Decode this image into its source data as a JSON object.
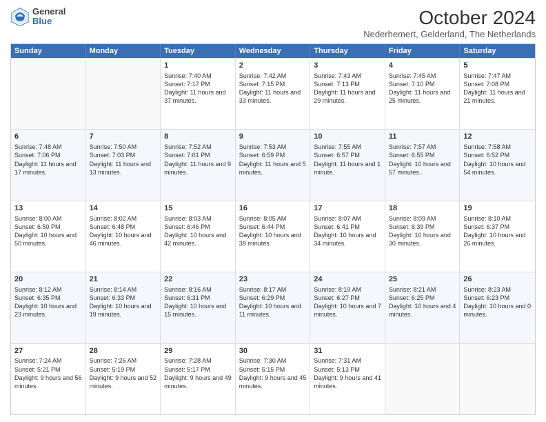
{
  "logo": {
    "general": "General",
    "blue": "Blue"
  },
  "title": "October 2024",
  "subtitle": "Nederhemert, Gelderland, The Netherlands",
  "days": [
    "Sunday",
    "Monday",
    "Tuesday",
    "Wednesday",
    "Thursday",
    "Friday",
    "Saturday"
  ],
  "weeks": [
    [
      {
        "num": "",
        "sunrise": "",
        "sunset": "",
        "daylight": ""
      },
      {
        "num": "",
        "sunrise": "",
        "sunset": "",
        "daylight": ""
      },
      {
        "num": "1",
        "sunrise": "Sunrise: 7:40 AM",
        "sunset": "Sunset: 7:17 PM",
        "daylight": "Daylight: 11 hours and 37 minutes."
      },
      {
        "num": "2",
        "sunrise": "Sunrise: 7:42 AM",
        "sunset": "Sunset: 7:15 PM",
        "daylight": "Daylight: 11 hours and 33 minutes."
      },
      {
        "num": "3",
        "sunrise": "Sunrise: 7:43 AM",
        "sunset": "Sunset: 7:13 PM",
        "daylight": "Daylight: 11 hours and 29 minutes."
      },
      {
        "num": "4",
        "sunrise": "Sunrise: 7:45 AM",
        "sunset": "Sunset: 7:10 PM",
        "daylight": "Daylight: 11 hours and 25 minutes."
      },
      {
        "num": "5",
        "sunrise": "Sunrise: 7:47 AM",
        "sunset": "Sunset: 7:08 PM",
        "daylight": "Daylight: 11 hours and 21 minutes."
      }
    ],
    [
      {
        "num": "6",
        "sunrise": "Sunrise: 7:48 AM",
        "sunset": "Sunset: 7:06 PM",
        "daylight": "Daylight: 11 hours and 17 minutes."
      },
      {
        "num": "7",
        "sunrise": "Sunrise: 7:50 AM",
        "sunset": "Sunset: 7:03 PM",
        "daylight": "Daylight: 11 hours and 13 minutes."
      },
      {
        "num": "8",
        "sunrise": "Sunrise: 7:52 AM",
        "sunset": "Sunset: 7:01 PM",
        "daylight": "Daylight: 11 hours and 9 minutes."
      },
      {
        "num": "9",
        "sunrise": "Sunrise: 7:53 AM",
        "sunset": "Sunset: 6:59 PM",
        "daylight": "Daylight: 11 hours and 5 minutes."
      },
      {
        "num": "10",
        "sunrise": "Sunrise: 7:55 AM",
        "sunset": "Sunset: 6:57 PM",
        "daylight": "Daylight: 11 hours and 1 minute."
      },
      {
        "num": "11",
        "sunrise": "Sunrise: 7:57 AM",
        "sunset": "Sunset: 6:55 PM",
        "daylight": "Daylight: 10 hours and 57 minutes."
      },
      {
        "num": "12",
        "sunrise": "Sunrise: 7:58 AM",
        "sunset": "Sunset: 6:52 PM",
        "daylight": "Daylight: 10 hours and 54 minutes."
      }
    ],
    [
      {
        "num": "13",
        "sunrise": "Sunrise: 8:00 AM",
        "sunset": "Sunset: 6:50 PM",
        "daylight": "Daylight: 10 hours and 50 minutes."
      },
      {
        "num": "14",
        "sunrise": "Sunrise: 8:02 AM",
        "sunset": "Sunset: 6:48 PM",
        "daylight": "Daylight: 10 hours and 46 minutes."
      },
      {
        "num": "15",
        "sunrise": "Sunrise: 8:03 AM",
        "sunset": "Sunset: 6:46 PM",
        "daylight": "Daylight: 10 hours and 42 minutes."
      },
      {
        "num": "16",
        "sunrise": "Sunrise: 8:05 AM",
        "sunset": "Sunset: 6:44 PM",
        "daylight": "Daylight: 10 hours and 38 minutes."
      },
      {
        "num": "17",
        "sunrise": "Sunrise: 8:07 AM",
        "sunset": "Sunset: 6:41 PM",
        "daylight": "Daylight: 10 hours and 34 minutes."
      },
      {
        "num": "18",
        "sunrise": "Sunrise: 8:09 AM",
        "sunset": "Sunset: 6:39 PM",
        "daylight": "Daylight: 10 hours and 30 minutes."
      },
      {
        "num": "19",
        "sunrise": "Sunrise: 8:10 AM",
        "sunset": "Sunset: 6:37 PM",
        "daylight": "Daylight: 10 hours and 26 minutes."
      }
    ],
    [
      {
        "num": "20",
        "sunrise": "Sunrise: 8:12 AM",
        "sunset": "Sunset: 6:35 PM",
        "daylight": "Daylight: 10 hours and 23 minutes."
      },
      {
        "num": "21",
        "sunrise": "Sunrise: 8:14 AM",
        "sunset": "Sunset: 6:33 PM",
        "daylight": "Daylight: 10 hours and 19 minutes."
      },
      {
        "num": "22",
        "sunrise": "Sunrise: 8:16 AM",
        "sunset": "Sunset: 6:31 PM",
        "daylight": "Daylight: 10 hours and 15 minutes."
      },
      {
        "num": "23",
        "sunrise": "Sunrise: 8:17 AM",
        "sunset": "Sunset: 6:29 PM",
        "daylight": "Daylight: 10 hours and 11 minutes."
      },
      {
        "num": "24",
        "sunrise": "Sunrise: 8:19 AM",
        "sunset": "Sunset: 6:27 PM",
        "daylight": "Daylight: 10 hours and 7 minutes."
      },
      {
        "num": "25",
        "sunrise": "Sunrise: 8:21 AM",
        "sunset": "Sunset: 6:25 PM",
        "daylight": "Daylight: 10 hours and 4 minutes."
      },
      {
        "num": "26",
        "sunrise": "Sunrise: 8:23 AM",
        "sunset": "Sunset: 6:23 PM",
        "daylight": "Daylight: 10 hours and 0 minutes."
      }
    ],
    [
      {
        "num": "27",
        "sunrise": "Sunrise: 7:24 AM",
        "sunset": "Sunset: 5:21 PM",
        "daylight": "Daylight: 9 hours and 56 minutes."
      },
      {
        "num": "28",
        "sunrise": "Sunrise: 7:26 AM",
        "sunset": "Sunset: 5:19 PM",
        "daylight": "Daylight: 9 hours and 52 minutes."
      },
      {
        "num": "29",
        "sunrise": "Sunrise: 7:28 AM",
        "sunset": "Sunset: 5:17 PM",
        "daylight": "Daylight: 9 hours and 49 minutes."
      },
      {
        "num": "30",
        "sunrise": "Sunrise: 7:30 AM",
        "sunset": "Sunset: 5:15 PM",
        "daylight": "Daylight: 9 hours and 45 minutes."
      },
      {
        "num": "31",
        "sunrise": "Sunrise: 7:31 AM",
        "sunset": "Sunset: 5:13 PM",
        "daylight": "Daylight: 9 hours and 41 minutes."
      },
      {
        "num": "",
        "sunrise": "",
        "sunset": "",
        "daylight": ""
      },
      {
        "num": "",
        "sunrise": "",
        "sunset": "",
        "daylight": ""
      }
    ]
  ]
}
